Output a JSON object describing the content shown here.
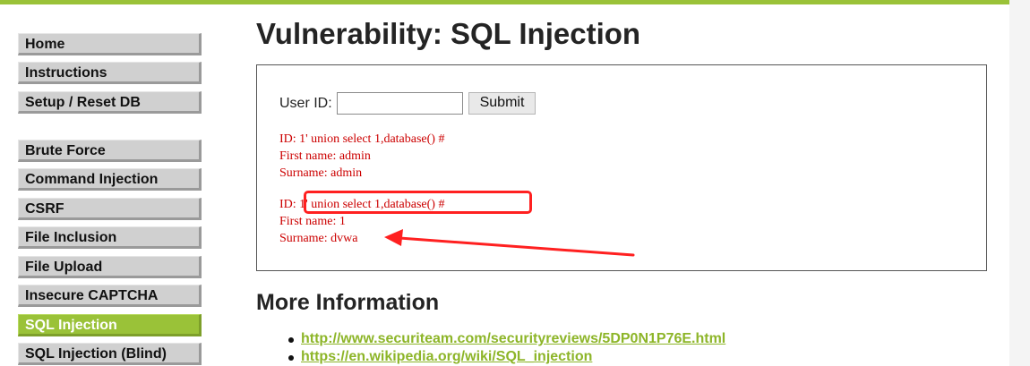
{
  "sidebar": {
    "items": [
      {
        "label": "Home",
        "active": false
      },
      {
        "label": "Instructions",
        "active": false
      },
      {
        "label": "Setup / Reset DB",
        "active": false
      },
      {
        "label": "Brute Force",
        "active": false
      },
      {
        "label": "Command Injection",
        "active": false
      },
      {
        "label": "CSRF",
        "active": false
      },
      {
        "label": "File Inclusion",
        "active": false
      },
      {
        "label": "File Upload",
        "active": false
      },
      {
        "label": "Insecure CAPTCHA",
        "active": false
      },
      {
        "label": "SQL Injection",
        "active": true
      },
      {
        "label": "SQL Injection (Blind)",
        "active": false
      }
    ]
  },
  "main": {
    "title": "Vulnerability: SQL Injection",
    "form": {
      "label": "User ID:",
      "input_value": "",
      "submit_label": "Submit"
    },
    "results": [
      {
        "id_line": "ID: 1' union select 1,database() #",
        "first_name_line": "First name: admin",
        "surname_line": "Surname: admin"
      },
      {
        "id_prefix": "ID: ",
        "id_value": "1' union select 1,database() #",
        "first_name_line": "First name: 1",
        "surname_line": "Surname: dvwa"
      }
    ],
    "more_info_title": "More Information",
    "links": [
      "http://www.securiteam.com/securityreviews/5DP0N1P76E.html",
      "https://en.wikipedia.org/wiki/SQL_injection"
    ]
  },
  "colors": {
    "accent": "#9ac238",
    "result_text": "#cc0000",
    "annotation": "#ff2020",
    "link": "#8db528"
  }
}
